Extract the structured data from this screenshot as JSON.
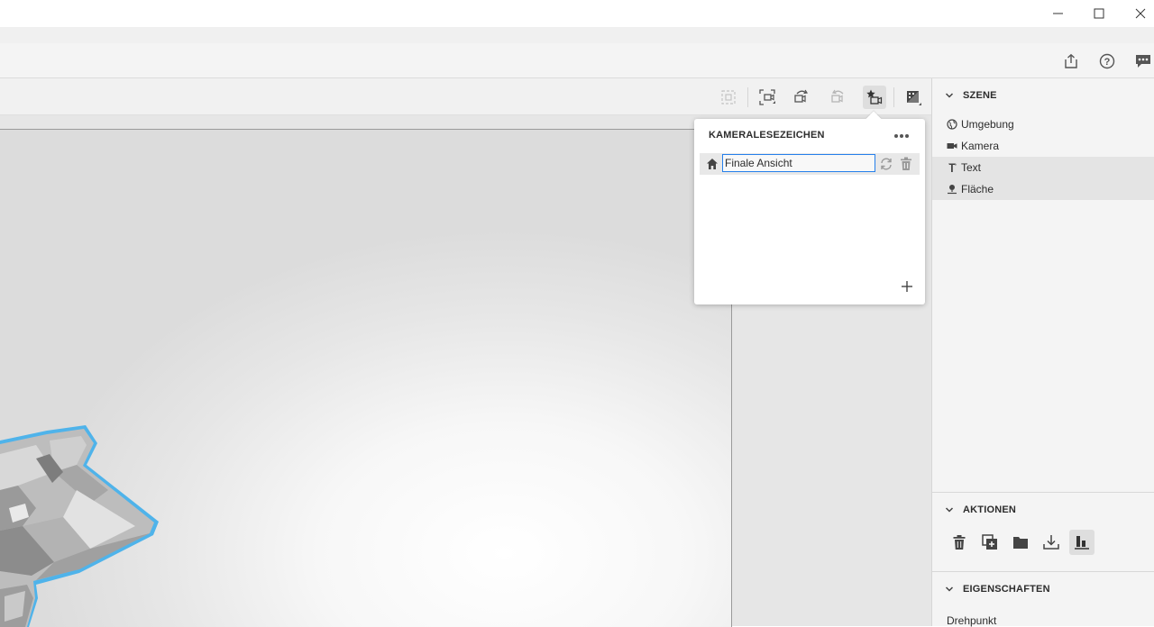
{
  "window": {
    "minimize_label": "minimize",
    "maximize_label": "maximize",
    "close_label": "close"
  },
  "header": {
    "icons": [
      "share-icon",
      "help-icon",
      "feedback-icon"
    ]
  },
  "toolbar": {
    "icons": [
      "frame-selection-icon",
      "fit-view-icon",
      "undo-camera-icon",
      "redo-camera-icon",
      "camera-bookmarks-icon",
      "render-preview-icon"
    ],
    "active": "camera-bookmarks-icon"
  },
  "bookmarks_popover": {
    "title": "KAMERALESEZEICHEN",
    "items": [
      {
        "name": "Finale Ansicht"
      }
    ]
  },
  "scene_panel": {
    "scene_title": "SZENE",
    "scene_items": [
      {
        "label": "Umgebung",
        "icon": "globe-icon",
        "selected": false
      },
      {
        "label": "Kamera",
        "icon": "camera-icon",
        "selected": false
      },
      {
        "label": "Text",
        "icon": "text-3d-icon",
        "selected": true
      },
      {
        "label": "Fläche",
        "icon": "ground-plane-icon",
        "selected": true
      }
    ],
    "actions_title": "AKTIONEN",
    "action_icons": [
      "delete-icon",
      "duplicate-icon",
      "group-icon",
      "drop-to-ground-icon",
      "align-icon"
    ],
    "properties_title": "EIGENSCHAFTEN",
    "properties_first_label": "Drehpunkt"
  },
  "colors": {
    "selection_outline": "#4fb3ea",
    "focus_border": "#2680eb"
  }
}
